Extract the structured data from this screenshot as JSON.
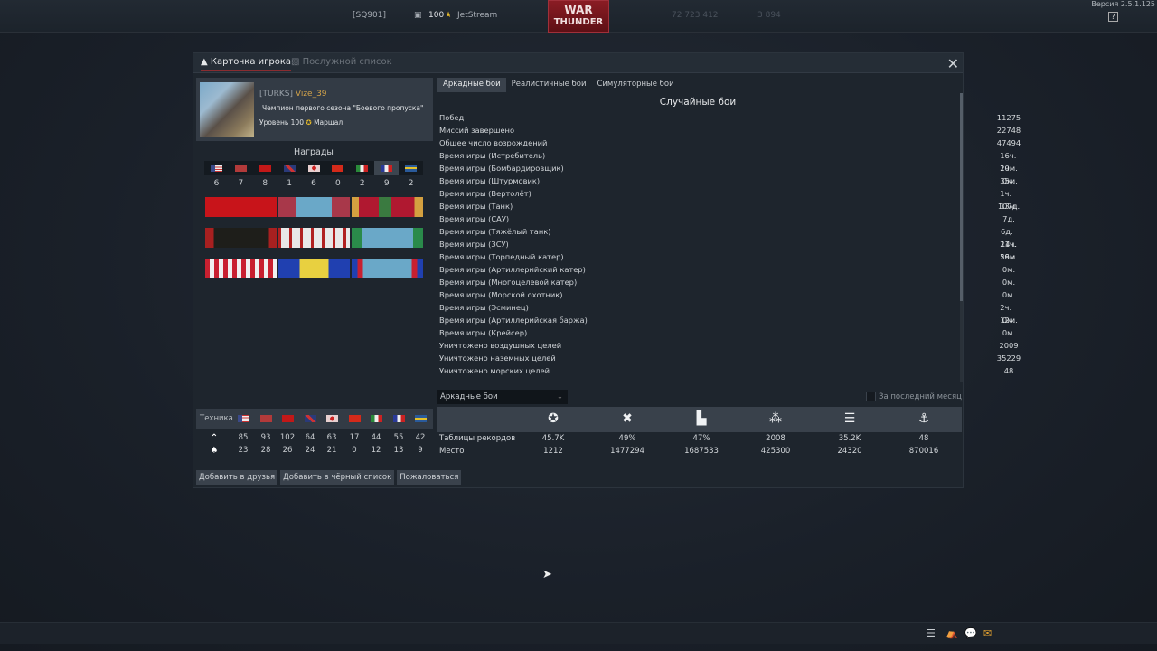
{
  "topbar": {
    "squadron": "[SQ901]",
    "level": "100",
    "player": "JetStream",
    "logo_line1": "WAR",
    "logo_line2": "THUNDER",
    "silver_lions": "72 723 412",
    "golden_eagles": "3 894",
    "version": "Версия 2.5.1.125",
    "help": "?"
  },
  "window": {
    "tabs": [
      {
        "label": "Карточка игрока",
        "active": true
      },
      {
        "label": "Послужной список",
        "active": false
      }
    ],
    "close": "✕"
  },
  "profile": {
    "squad": "[TURKS]",
    "nickname": "Vize_39",
    "title": "Чемпион первого сезона \"Боевого пропуска\"",
    "level_text": "Уровень 100",
    "rank": "Маршал"
  },
  "awards": {
    "title": "Награды",
    "nations": [
      "USA",
      "Germany",
      "USSR",
      "Britain",
      "Japan",
      "China",
      "Italy",
      "France",
      "Sweden"
    ],
    "selected": "France",
    "counts": [
      "6",
      "7",
      "8",
      "1",
      "6",
      "0",
      "2",
      "9",
      "2"
    ]
  },
  "modes": {
    "tabs": [
      "Аркадные бои",
      "Реалистичные бои",
      "Симуляторные бои"
    ],
    "active": "Аркадные бои"
  },
  "stats": {
    "title": "Случайные бои",
    "rows": [
      {
        "label": "Побед",
        "value": "11275"
      },
      {
        "label": "Миссий завершено",
        "value": "22748"
      },
      {
        "label": "Общее число возрождений",
        "value": "47494"
      },
      {
        "label": "Время игры (Истребитель)",
        "value": "16ч. 20м."
      },
      {
        "label": "Время игры (Бомбардировщик)",
        "value": "1ч. 35м."
      },
      {
        "label": "Время игры (Штурмовик)",
        "value": "0м."
      },
      {
        "label": "Время игры (Вертолёт)",
        "value": "1ч. 13м."
      },
      {
        "label": "Время игры (Танк)",
        "value": "107д."
      },
      {
        "label": "Время игры (САУ)",
        "value": "7д."
      },
      {
        "label": "Время игры (Тяжёлый танк)",
        "value": "6д. 14ч."
      },
      {
        "label": "Время игры (ЗСУ)",
        "value": "21ч. 29м."
      },
      {
        "label": "Время игры (Торпедный катер)",
        "value": "56м."
      },
      {
        "label": "Время игры (Артиллерийский катер)",
        "value": "0м."
      },
      {
        "label": "Время игры (Многоцелевой катер)",
        "value": "0м."
      },
      {
        "label": "Время игры (Морской охотник)",
        "value": "0м."
      },
      {
        "label": "Время игры (Эсминец)",
        "value": "2ч. 12м."
      },
      {
        "label": "Время игры (Артиллерийская баржа)",
        "value": "0м."
      },
      {
        "label": "Время игры (Крейсер)",
        "value": "0м."
      },
      {
        "label": "Уничтожено воздушных целей",
        "value": "2009"
      },
      {
        "label": "Уничтожено наземных целей",
        "value": "35229"
      },
      {
        "label": "Уничтожено морских целей",
        "value": "48"
      }
    ]
  },
  "leaderboard": {
    "mode_select": "Аркадные бои",
    "last_month": "За последний месяц",
    "row1_label": "Таблицы рекордов",
    "row2_label": "Место",
    "columns": [
      {
        "icon": "victories-icon",
        "value": "45.7K",
        "place": "1212"
      },
      {
        "icon": "kills-icon",
        "value": "49%",
        "place": "1477294"
      },
      {
        "icon": "podium-icon",
        "value": "47%",
        "place": "1687533"
      },
      {
        "icon": "air-kills-icon",
        "value": "2008",
        "place": "425300"
      },
      {
        "icon": "ground-kills-icon",
        "value": "35.2K",
        "place": "24320"
      },
      {
        "icon": "naval-kills-icon",
        "value": "48",
        "place": "870016"
      }
    ]
  },
  "vehicles": {
    "label": "Техника",
    "researched": [
      "85",
      "93",
      "102",
      "64",
      "63",
      "17",
      "44",
      "55",
      "42"
    ],
    "elite": [
      "23",
      "28",
      "26",
      "24",
      "21",
      "0",
      "12",
      "13",
      "9"
    ]
  },
  "buttons": {
    "add_friend": "Добавить в друзья",
    "add_blacklist": "Добавить в чёрный список",
    "complain": "Пожаловаться"
  }
}
